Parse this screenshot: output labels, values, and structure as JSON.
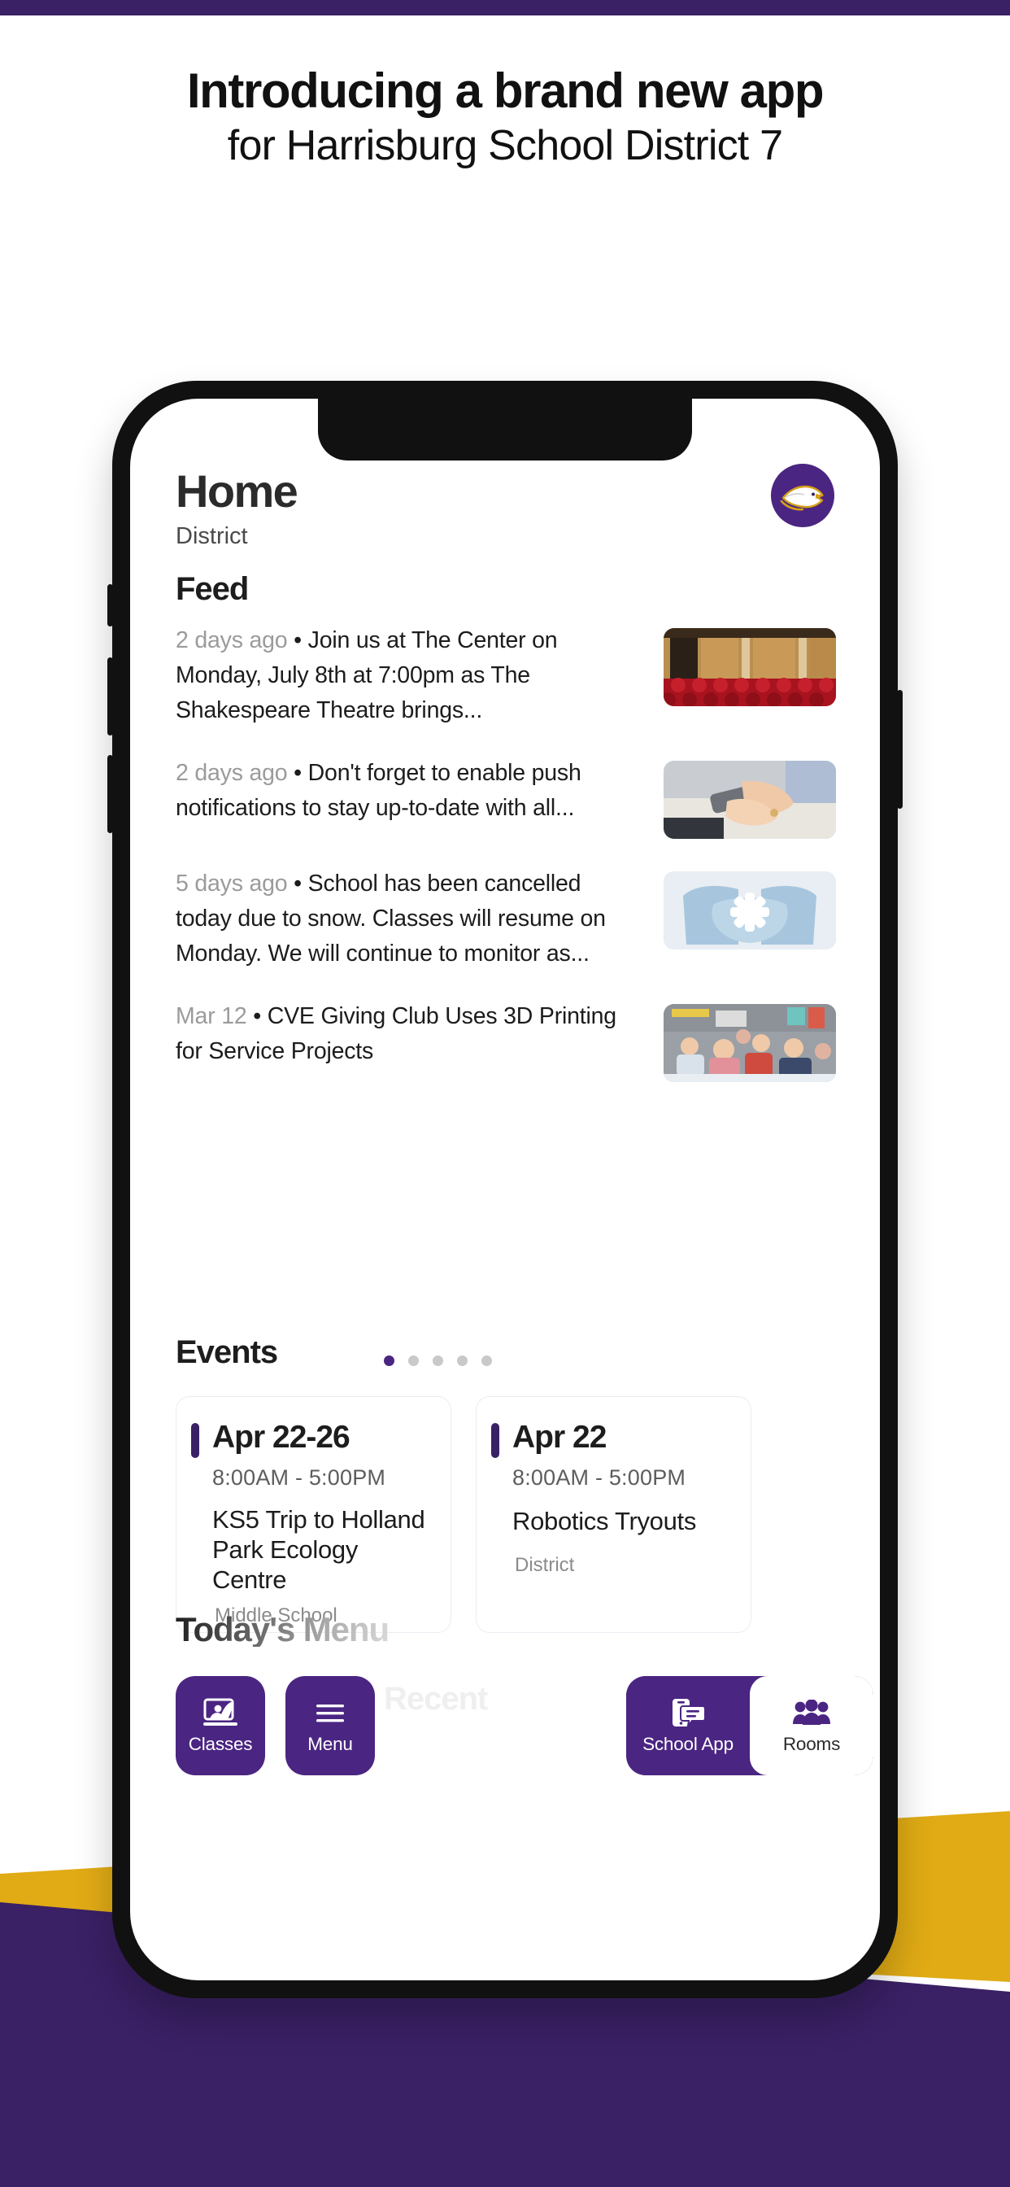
{
  "brand": {
    "purple": "#3a2065",
    "purple_light": "#4b2582",
    "gold": "#e0ab15",
    "dark": "#111111"
  },
  "promo": {
    "headline_line1": "Introducing a brand new app",
    "headline_line2": "for Harrisburg School District 7"
  },
  "app": {
    "title": "Home",
    "subtitle": "District",
    "avatar_icon": "eagle-mascot-logo",
    "feed": {
      "title": "Feed",
      "items": [
        {
          "time": "2 days ago",
          "separator": "•",
          "text": "Join us at The Center on Monday, July 8th at 7:00pm as The Shakespeare Theatre brings...",
          "thumbnail": "auditorium-red-seats-photo"
        },
        {
          "time": "2 days ago",
          "separator": "•",
          "text": "Don't forget to enable push notifications to stay up-to-date with all...",
          "thumbnail": "hands-holding-smartphone-photo"
        },
        {
          "time": "5 days ago",
          "separator": "•",
          "text": "School has been cancelled today due to snow. Classes will resume on Monday. We will continue to monitor as...",
          "thumbnail": "mittens-holding-snowflake-photo"
        },
        {
          "time": "Mar 12",
          "separator": "•",
          "text": "CVE Giving Club Uses 3D Printing for Service Projects",
          "thumbnail": "classroom-students-raising-hands-photo"
        }
      ]
    },
    "events": {
      "title": "Events",
      "pager": {
        "count": 5,
        "active_index": 0
      },
      "cards": [
        {
          "date": "Apr 22-26",
          "time": "8:00AM  -  5:00PM",
          "name": "KS5 Trip to Holland Park Ecology Centre",
          "scope": "Middle School"
        },
        {
          "date": "Apr 22",
          "time": "8:00AM  -  5:00PM",
          "name": "Robotics Tryouts",
          "scope": "District"
        }
      ]
    },
    "menu_section": {
      "title": "Today's Menu",
      "ghost_text": "Recent"
    },
    "tabbar": {
      "left": [
        {
          "label": "Classes",
          "icon": "presentation-person-icon",
          "active": false
        },
        {
          "label": "Menu",
          "icon": "hamburger-menu-icon",
          "active": false
        }
      ],
      "right": [
        {
          "label": "School App",
          "icon": "phone-chat-icon",
          "active": false
        },
        {
          "label": "Rooms",
          "icon": "people-group-icon",
          "active": true
        }
      ]
    }
  }
}
